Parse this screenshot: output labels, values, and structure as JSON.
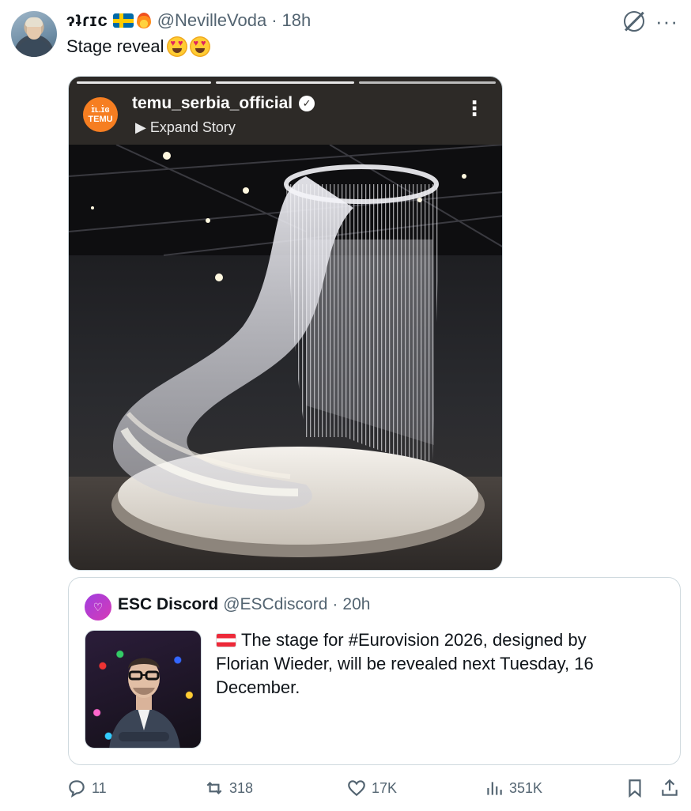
{
  "author": {
    "display_name": "ɂʇɾɪc",
    "handle": "@NevilleVoda",
    "time": "18h",
    "dot": "·"
  },
  "tweet": {
    "text": "Stage reveal"
  },
  "story": {
    "username": "temu_serbia_official",
    "expand_label": "Expand Story",
    "logo_top": "ɪ̇ʟ.ɪ̇ɞ",
    "logo_text": "TEMU",
    "verified_mark": "✓",
    "more": "⋮"
  },
  "quote": {
    "name": "ESC Discord",
    "handle": "@ESCdiscord",
    "dot": "·",
    "time": "20h",
    "text": "The stage for #Eurovision 2026, designed by Florian Wieder, will be revealed next Tuesday, 16 December."
  },
  "actions": {
    "replies": "11",
    "retweets": "318",
    "likes": "17K",
    "views": "351K"
  },
  "icons": {
    "more": "···"
  }
}
